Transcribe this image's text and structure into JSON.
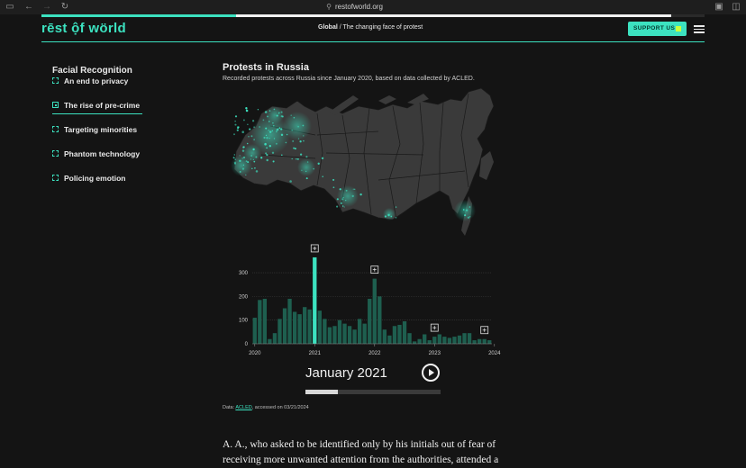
{
  "browser": {
    "url": "restofworld.org",
    "icons": [
      "sidebar-icon",
      "back-icon",
      "forward-icon",
      "reload-icon",
      "lock-icon",
      "share-icon",
      "tabs-icon"
    ]
  },
  "reading_progress": 0.42,
  "header": {
    "logo": "rēst ộf wörld",
    "section": "Global",
    "separator": " / ",
    "story": "The changing face of protest",
    "support_label": "SUPPORT US"
  },
  "toc": {
    "title": "Facial Recognition",
    "items": [
      {
        "label": "An end to privacy",
        "active": false
      },
      {
        "label": "The rise of pre-crime",
        "active": true
      },
      {
        "label": "Targeting minorities",
        "active": false
      },
      {
        "label": "Phantom technology",
        "active": false
      },
      {
        "label": "Policing emotion",
        "active": false
      }
    ]
  },
  "chart": {
    "title": "Protests in Russia",
    "subtitle": "Recorded protests across Russia since January 2020, based on data collected by ACLED."
  },
  "chart_data": {
    "type": "bar",
    "title": "Protests in Russia",
    "xlabel": "",
    "ylabel": "",
    "ylim": [
      0,
      380
    ],
    "yticks": [
      "0",
      "100",
      "200",
      "300"
    ],
    "xticks": [
      "2020",
      "2021",
      "2022",
      "2023",
      "2024"
    ],
    "x_start_year": 2020,
    "values": [
      110,
      185,
      190,
      20,
      45,
      105,
      150,
      190,
      135,
      125,
      155,
      145,
      365,
      140,
      105,
      70,
      75,
      100,
      85,
      75,
      60,
      105,
      85,
      190,
      275,
      200,
      60,
      35,
      75,
      80,
      95,
      45,
      10,
      20,
      40,
      15,
      30,
      40,
      30,
      25,
      30,
      35,
      45,
      45,
      15,
      20,
      20,
      15
    ],
    "highlight_index": 12,
    "annotation_indices": [
      12,
      24,
      36,
      46
    ],
    "colors": {
      "bar": "#1e5f4f",
      "highlight": "#3ce2c0",
      "grid": "#3a3a3a"
    }
  },
  "map": {
    "land_color": "#3a3a3a",
    "border_color": "#1a1a1a",
    "dot_color": "#3ce2c0"
  },
  "player": {
    "current_label": "January 2021",
    "progress": 0.24
  },
  "source": {
    "prefix": "Data: ",
    "link": "ACLED",
    "suffix": ", accessed on 03/21/2024"
  },
  "article": {
    "paragraph": "A. A., who asked to be identified only by his initials out of fear of receiving more unwanted attention from the authorities, attended a"
  }
}
